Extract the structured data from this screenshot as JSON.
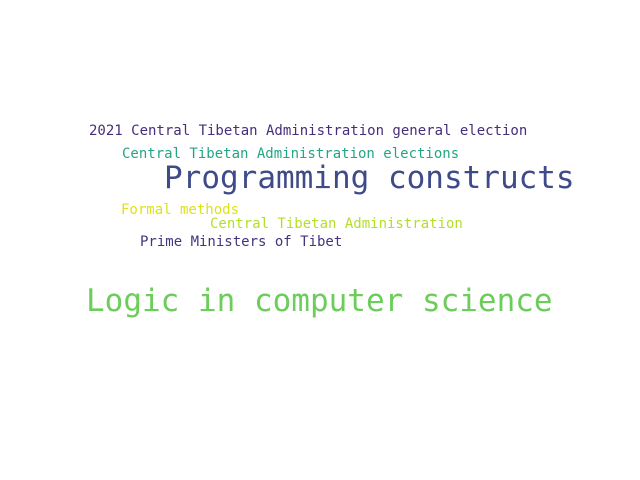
{
  "words": [
    {
      "text": "2021 Central Tibetan Administration general election",
      "color": "#472d7b"
    },
    {
      "text": "Central Tibetan Administration elections",
      "color": "#25a584"
    },
    {
      "text": "Programming constructs",
      "color": "#3e4a89"
    },
    {
      "text": "Formal methods",
      "color": "#dde318"
    },
    {
      "text": "Central Tibetan Administration",
      "color": "#b5de2b"
    },
    {
      "text": "Prime Ministers of Tibet",
      "color": "#46337e"
    },
    {
      "text": "Logic in computer science",
      "color": "#6ccd5a"
    }
  ]
}
